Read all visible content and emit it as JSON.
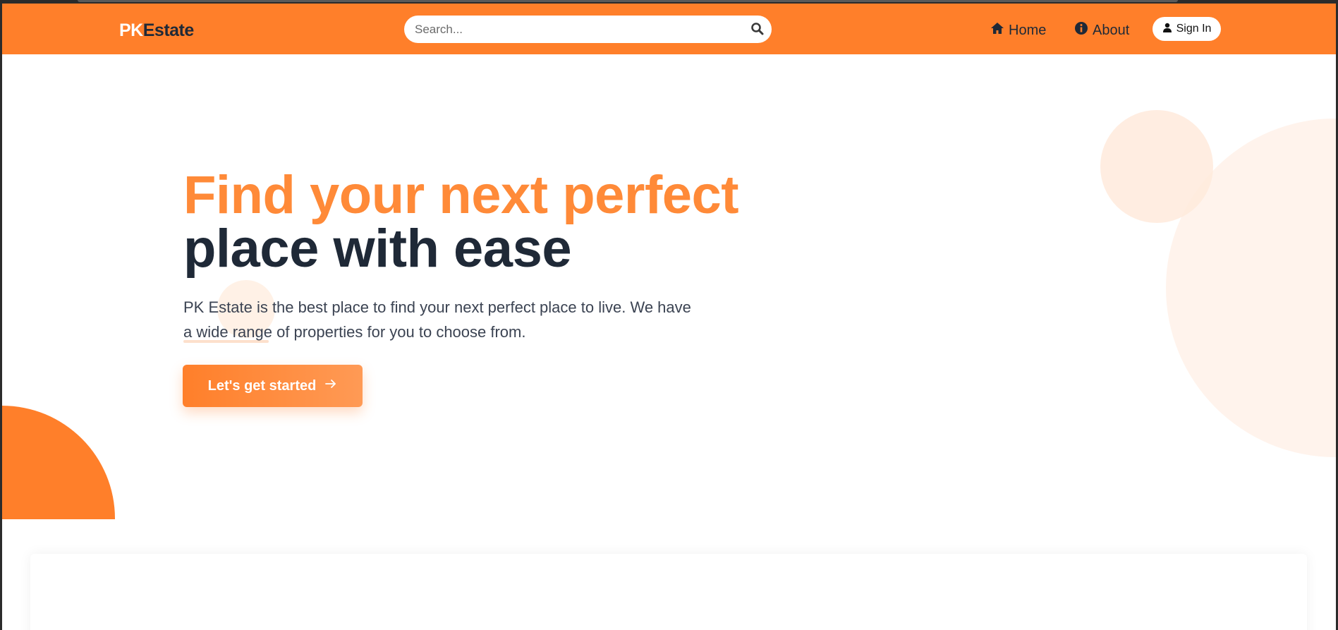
{
  "header": {
    "logo_pk": "PK",
    "logo_estate": "Estate",
    "search_placeholder": "Search...",
    "nav": [
      {
        "label": "Home",
        "icon": "home-icon"
      },
      {
        "label": "About",
        "icon": "info-icon"
      }
    ],
    "signin_label": "Sign In",
    "signin_icon": "user-icon"
  },
  "hero": {
    "title_line1": "Find your next perfect",
    "title_line2": "place with ease",
    "description": "PK Estate is the best place to find your next perfect place to live. We have a wide range of properties for you to choose from.",
    "cta_label": "Let's get started",
    "cta_icon": "arrow-right-icon"
  },
  "colors": {
    "brand": "#ff7f2a",
    "dark": "#1f2937",
    "text": "#3b4352"
  }
}
